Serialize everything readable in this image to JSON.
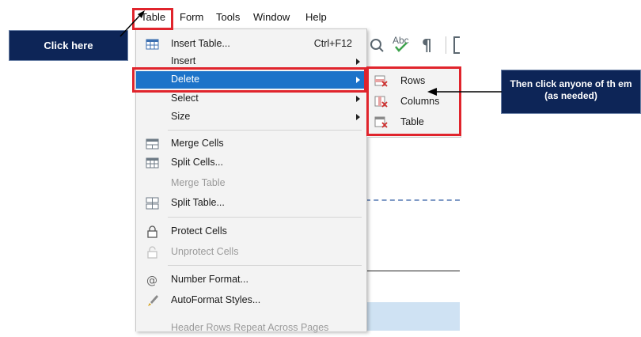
{
  "menubar": {
    "table": "Table",
    "form": "Form",
    "tools": "Tools",
    "window": "Window",
    "help": "Help"
  },
  "menu": {
    "items": [
      {
        "label": "Insert Table...",
        "shortcut": "Ctrl+F12",
        "icon": "insert-table-icon"
      },
      {
        "label": "Insert",
        "submenu": true
      },
      {
        "label": "Delete",
        "submenu": true,
        "highlighted": true
      },
      {
        "label": "Select",
        "submenu": true
      },
      {
        "label": "Size",
        "submenu": true
      },
      {
        "label": "Merge Cells",
        "icon": "merge-cells-icon"
      },
      {
        "label": "Split Cells...",
        "icon": "split-cells-icon"
      },
      {
        "label": "Merge Table",
        "disabled": true
      },
      {
        "label": "Split Table...",
        "icon": "split-table-icon"
      },
      {
        "label": "Protect Cells",
        "icon": "lock-icon"
      },
      {
        "label": "Unprotect Cells",
        "icon": "unlock-icon",
        "disabled": true
      },
      {
        "label": "Number Format...",
        "icon": "at-sign-icon"
      },
      {
        "label": "AutoFormat Styles...",
        "icon": "brush-icon"
      },
      {
        "label": "Header Rows Repeat Across Pages",
        "disabled": true
      }
    ]
  },
  "submenu": {
    "items": [
      {
        "label": "Rows",
        "icon": "delete-rows-icon"
      },
      {
        "label": "Columns",
        "icon": "delete-columns-icon"
      },
      {
        "label": "Table",
        "icon": "delete-table-icon"
      }
    ]
  },
  "callouts": {
    "click_here": "Click here",
    "then_line1": "Then click anyone of th em",
    "then_line2": "(as needed)"
  },
  "colors": {
    "highlight": "#1d73c9",
    "annotation_red": "#e0242c",
    "callout_bg": "#0d2557"
  }
}
